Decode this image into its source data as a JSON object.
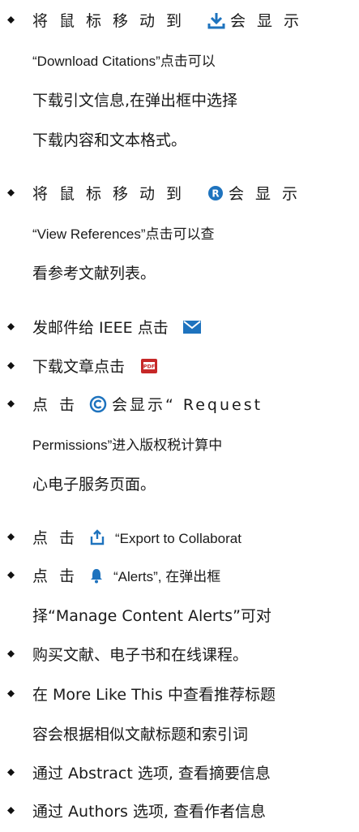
{
  "icons": {
    "download": "download-icon",
    "references": "references-r-icon",
    "mail": "mail-icon",
    "pdf": "pdf-icon",
    "copyright": "copyright-icon",
    "export": "export-icon",
    "alerts": "bell-icon"
  },
  "colors": {
    "accent": "#1e73be",
    "text": "#1a1a1a",
    "pdf": "#c62828"
  },
  "items": {
    "i1": {
      "l1_a": "将鼠标移动到",
      "l1_b": "会显示",
      "l2": "“Download Citations”点击可以",
      "l3": "下载引文信息,在弹出框中选择",
      "l4": "下载内容和文本格式。"
    },
    "i2": {
      "l1_a": "将鼠标移动到",
      "l1_b": "会显示",
      "l2": "“View References”点击可以查",
      "l3": "看参考文献列表。"
    },
    "i3": {
      "l1": "发邮件给 IEEE 点击"
    },
    "i4": {
      "l1": "下载文章点击"
    },
    "i5": {
      "l1_a": "点击",
      "l1_b": "会显示“ Request",
      "l2": "Permissions”进入版权税计算中",
      "l3": "心电子服务页面。"
    },
    "i6": {
      "l1_a": "点击",
      "l1_b": "“Export to Collaborat"
    },
    "i7": {
      "l1_a": "点击",
      "l1_b": "“Alerts”, 在弹出框",
      "l2": "择“Manage Content Alerts”可对"
    },
    "i8": {
      "l1": "购买文献、电子书和在线课程。"
    },
    "i9": {
      "l1": "在 More Like This 中查看推荐标题",
      "l2": "容会根据相似文献标题和索引词"
    },
    "i10": {
      "l1": "通过 Abstract 选项, 查看摘要信息"
    },
    "i11": {
      "l1": "通过 Authors 选项, 查看作者信息"
    }
  }
}
